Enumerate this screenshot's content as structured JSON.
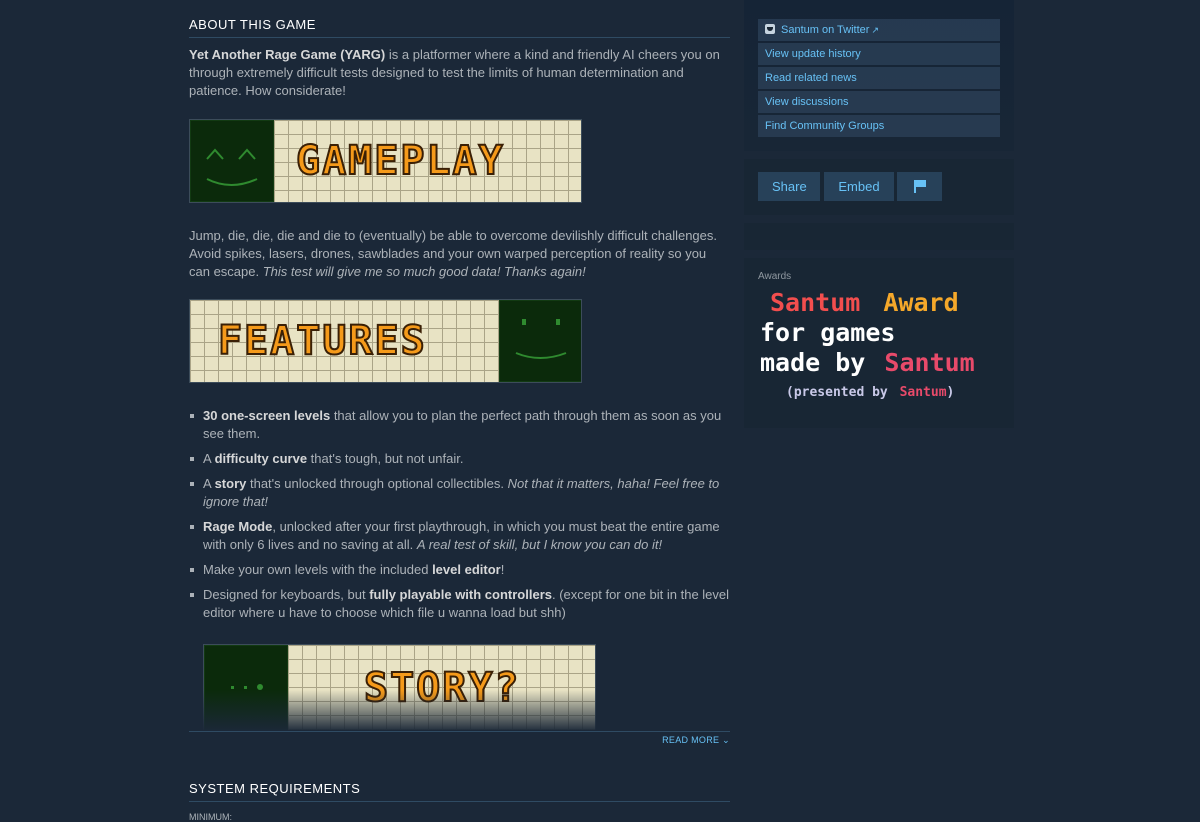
{
  "about": {
    "title": "ABOUT THIS GAME",
    "p1_bold": "Yet Another Rage Game (YARG)",
    "p1_rest": " is a platformer where a kind and friendly AI cheers you on through extremely difficult tests designed to test the limits of human determination and patience. How considerate!",
    "banner_gameplay": "GAMEPLAY",
    "p2_plain": "Jump, die, die, die and die to (eventually) be able to overcome devilishly difficult challenges. Avoid spikes, lasers, drones, sawblades and your own warped perception of reality so you can escape. ",
    "p2_italic": "This test will give me so much good data! Thanks again!",
    "banner_features": "FEATURES",
    "features": [
      {
        "bold": "30 one-screen levels",
        "rest": " that allow you to plan the perfect path through them as soon as you see them.",
        "pre": "",
        "italic": ""
      },
      {
        "pre": "A ",
        "bold": "difficulty curve",
        "rest": " that's tough, but not unfair.",
        "italic": ""
      },
      {
        "pre": "A ",
        "bold": "story",
        "rest": " that's unlocked through optional collectibles. ",
        "italic": "Not that it matters, haha! Feel free to ignore that!"
      },
      {
        "pre": "",
        "bold": "Rage Mode",
        "rest": ", unlocked after your first playthrough, in which you must beat the entire game with only 6 lives and no saving at all. ",
        "italic": "A real test of skill, but I know you can do it!"
      },
      {
        "pre": "Make your own levels with the included ",
        "bold": "level editor",
        "rest": "!",
        "italic": ""
      },
      {
        "pre": "Designed for keyboards, but ",
        "bold": "fully playable with controllers",
        "rest": ". (except for one bit in the level editor where u have to choose which file u wanna load but shh)",
        "italic": ""
      }
    ],
    "banner_story": "STORY?",
    "read_more": "READ MORE"
  },
  "sysreq": {
    "title": "SYSTEM REQUIREMENTS",
    "minimum": "MINIMUM:"
  },
  "links": [
    "Santum on Twitter",
    "View update history",
    "Read related news",
    "View discussions",
    "Find Community Groups"
  ],
  "share": {
    "share_label": "Share",
    "embed_label": "Embed"
  },
  "awards": {
    "label": "Awards",
    "line1_a": "Santum",
    "line1_b": "Award",
    "line2": "for games",
    "line3_a": "made by",
    "line3_b": "Santum",
    "line4_a": "(presented by",
    "line4_b": "Santum",
    "line4_c": ")"
  },
  "colors": {
    "background": "#1b2838",
    "link": "#67c1f5",
    "banner_orange": "#f59a1a",
    "face_green": "#0b2a0b"
  }
}
